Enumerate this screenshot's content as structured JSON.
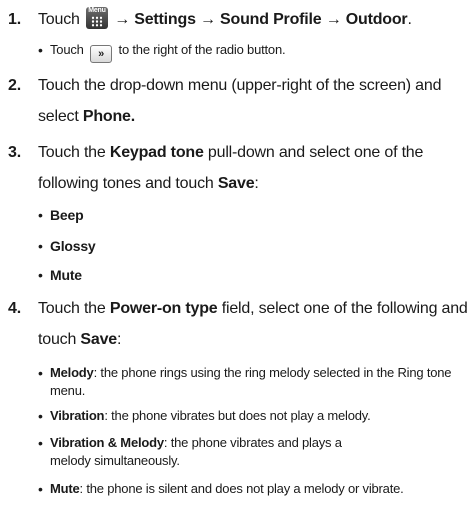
{
  "steps": [
    {
      "num": "1.",
      "touch": "Touch",
      "menu_icon_label": "Menu",
      "path": "→ Settings → Sound Profile → Outdoor",
      "end": ".",
      "sub": {
        "pre": "Touch",
        "button_glyph": "»",
        "post": "to the right of the radio button."
      }
    },
    {
      "num": "2.",
      "text": "Touch the drop-down menu (upper-right of the screen) and select",
      "bold": "Phone."
    },
    {
      "num": "3.",
      "pre": "Touch the",
      "bold1": "Keypad tone",
      "mid": "pull-down and select one of the following tones and touch",
      "bold2": "Save",
      "end": ":",
      "options": [
        "Beep",
        "Glossy",
        "Mute"
      ]
    },
    {
      "num": "4.",
      "pre": "Touch the",
      "bold1": "Power-on type",
      "mid": "field, select one of the following and touch",
      "bold2": "Save",
      "end": ":",
      "options": [
        {
          "term": "Melody",
          "desc": ": the phone rings using the ring melody selected in the Ring tone menu."
        },
        {
          "term": "Vibration",
          "desc": ": the phone vibrates but does not play a melody."
        },
        {
          "term": "Vibration & Melody",
          "desc": ": the phone vibrates and plays a melody simultaneously."
        },
        {
          "term": "Mute",
          "desc": ": the phone is silent and does not play a melody or vibrate."
        }
      ]
    }
  ],
  "icons": [
    "menu-icon",
    "double-chevron-right-icon"
  ]
}
